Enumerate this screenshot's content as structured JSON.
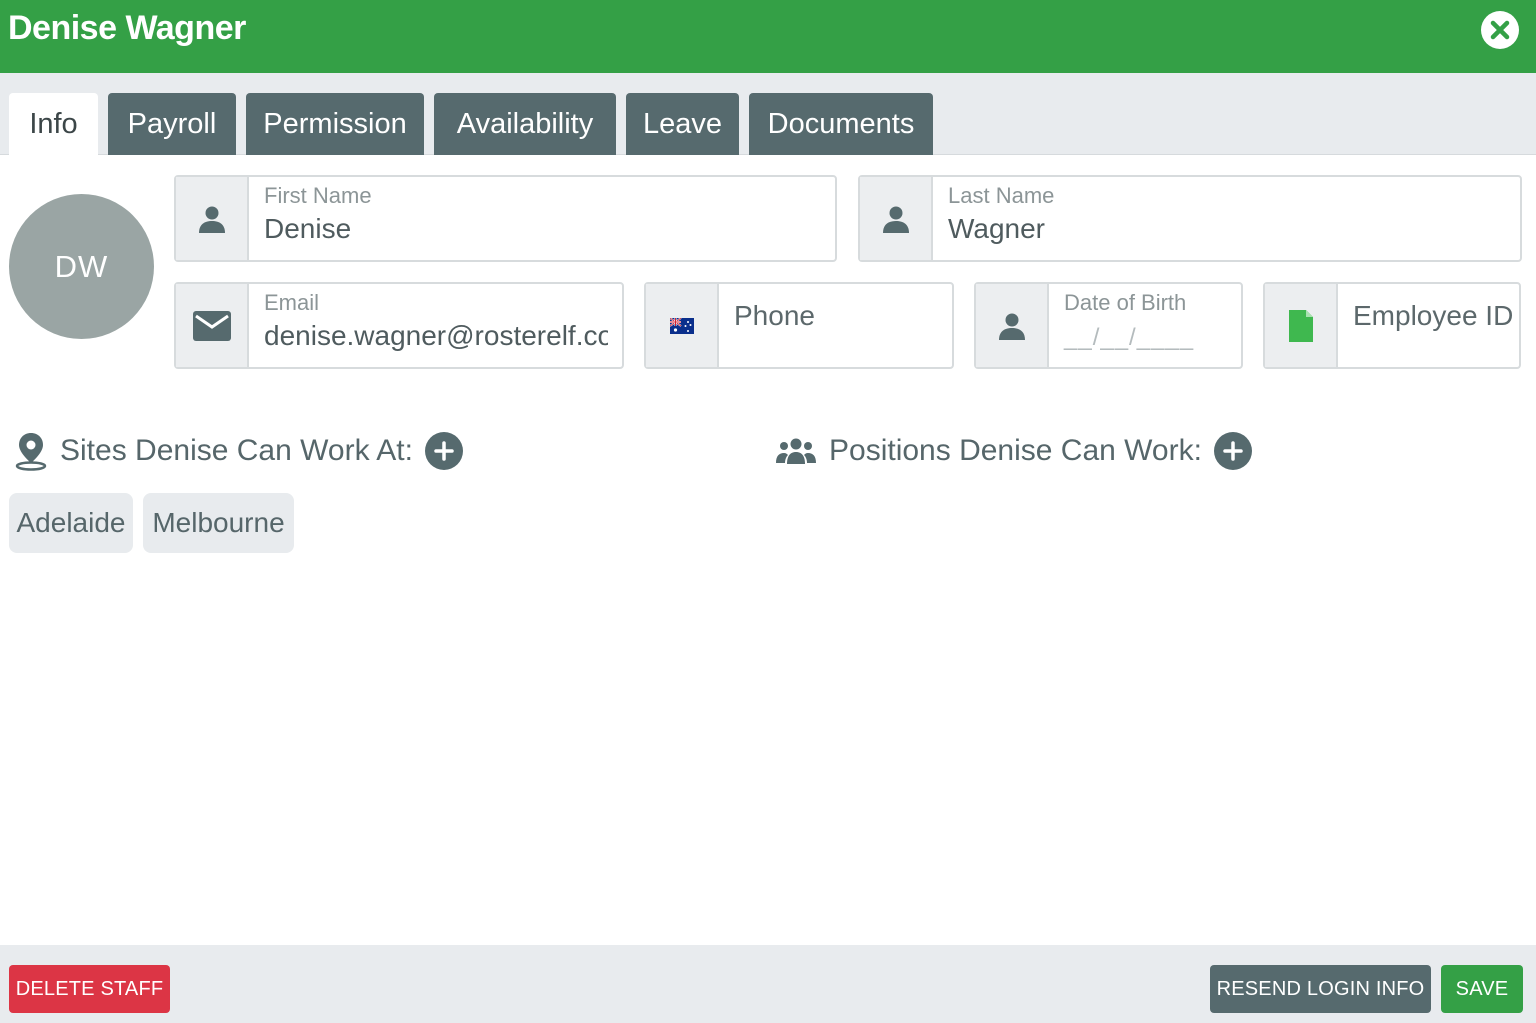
{
  "header": {
    "title": "Denise Wagner",
    "close_icon": "close-circle-icon"
  },
  "tabs": [
    {
      "label": "Info",
      "active": true
    },
    {
      "label": "Payroll",
      "active": false
    },
    {
      "label": "Permission",
      "active": false
    },
    {
      "label": "Availability",
      "active": false
    },
    {
      "label": "Leave",
      "active": false
    },
    {
      "label": "Documents",
      "active": false
    }
  ],
  "avatar": {
    "initials": "DW"
  },
  "fields": {
    "first_name": {
      "label": "First Name",
      "value": "Denise",
      "icon": "person-icon"
    },
    "last_name": {
      "label": "Last Name",
      "value": "Wagner",
      "icon": "person-icon"
    },
    "email": {
      "label": "Email",
      "value": "denise.wagner@rosterelf.com",
      "icon": "envelope-icon"
    },
    "phone": {
      "placeholder": "Phone",
      "icon": "australia-flag-icon"
    },
    "dob": {
      "label": "Date of Birth",
      "mask": "__/__/____",
      "icon": "person-icon"
    },
    "employee_id": {
      "placeholder": "Employee ID",
      "icon": "csv-file-icon"
    }
  },
  "sites": {
    "heading": "Sites Denise Can Work At:",
    "icon": "map-marker-icon",
    "items": [
      "Adelaide",
      "Melbourne"
    ]
  },
  "positions": {
    "heading": "Positions Denise Can Work:",
    "icon": "users-group-icon",
    "items": []
  },
  "footer": {
    "delete_label": "DELETE STAFF",
    "resend_label": "RESEND LOGIN INFO",
    "save_label": "SAVE"
  },
  "colors": {
    "brand_green": "#34a046",
    "slate": "#566a6e",
    "danger": "#dc3545",
    "light_bg": "#e8ebee"
  }
}
